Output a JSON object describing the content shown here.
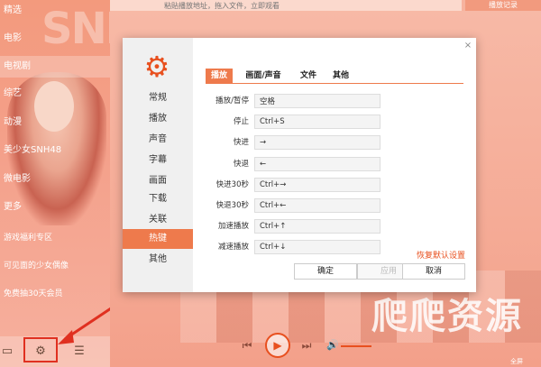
{
  "sidebar": {
    "watermark": "SNH",
    "items": [
      {
        "label": "精选",
        "active": false
      },
      {
        "label": "电影",
        "active": false
      },
      {
        "label": "电视剧",
        "active": true
      },
      {
        "label": "综艺",
        "active": false
      },
      {
        "label": "动漫",
        "active": false
      },
      {
        "label": "美少女SNH48",
        "active": false
      },
      {
        "label": "微电影",
        "active": false
      },
      {
        "label": "更多",
        "active": false
      },
      {
        "label": "游戏福利专区",
        "active": false
      },
      {
        "label": "可见面的少女偶像",
        "active": false
      },
      {
        "label": "免费抽30天会员",
        "active": false
      }
    ],
    "bottom_icons": [
      "folder-icon",
      "gear-icon",
      "list-icon"
    ]
  },
  "topbar": {
    "url_placeholder": "粘贴播放地址，拖入文件，立即观看",
    "history_label": "播放记录"
  },
  "dialog": {
    "nav": [
      "常规",
      "播放",
      "声音",
      "字幕",
      "画面",
      "下载",
      "关联",
      "热键",
      "其他"
    ],
    "active_nav": "热键",
    "tabs": [
      "播放",
      "画面/声音",
      "文件",
      "其他"
    ],
    "active_tab": "播放",
    "hotkeys": [
      {
        "label": "播放/暂停",
        "value": "空格"
      },
      {
        "label": "停止",
        "value": "Ctrl+S"
      },
      {
        "label": "快进",
        "value": "→"
      },
      {
        "label": "快退",
        "value": "←"
      },
      {
        "label": "快进30秒",
        "value": "Ctrl+→"
      },
      {
        "label": "快退30秒",
        "value": "Ctrl+←"
      },
      {
        "label": "加速播放",
        "value": "Ctrl+↑"
      },
      {
        "label": "减速播放",
        "value": "Ctrl+↓"
      }
    ],
    "restore_label": "恢复默认设置",
    "ok_label": "确定",
    "apply_label": "应用",
    "cancel_label": "取消",
    "close_glyph": "×"
  },
  "player": {
    "fullscreen_label": "全屏",
    "site_watermark": "爬爬资源"
  },
  "colors": {
    "accent": "#ee7a4c",
    "highlight_box": "#e03020"
  }
}
